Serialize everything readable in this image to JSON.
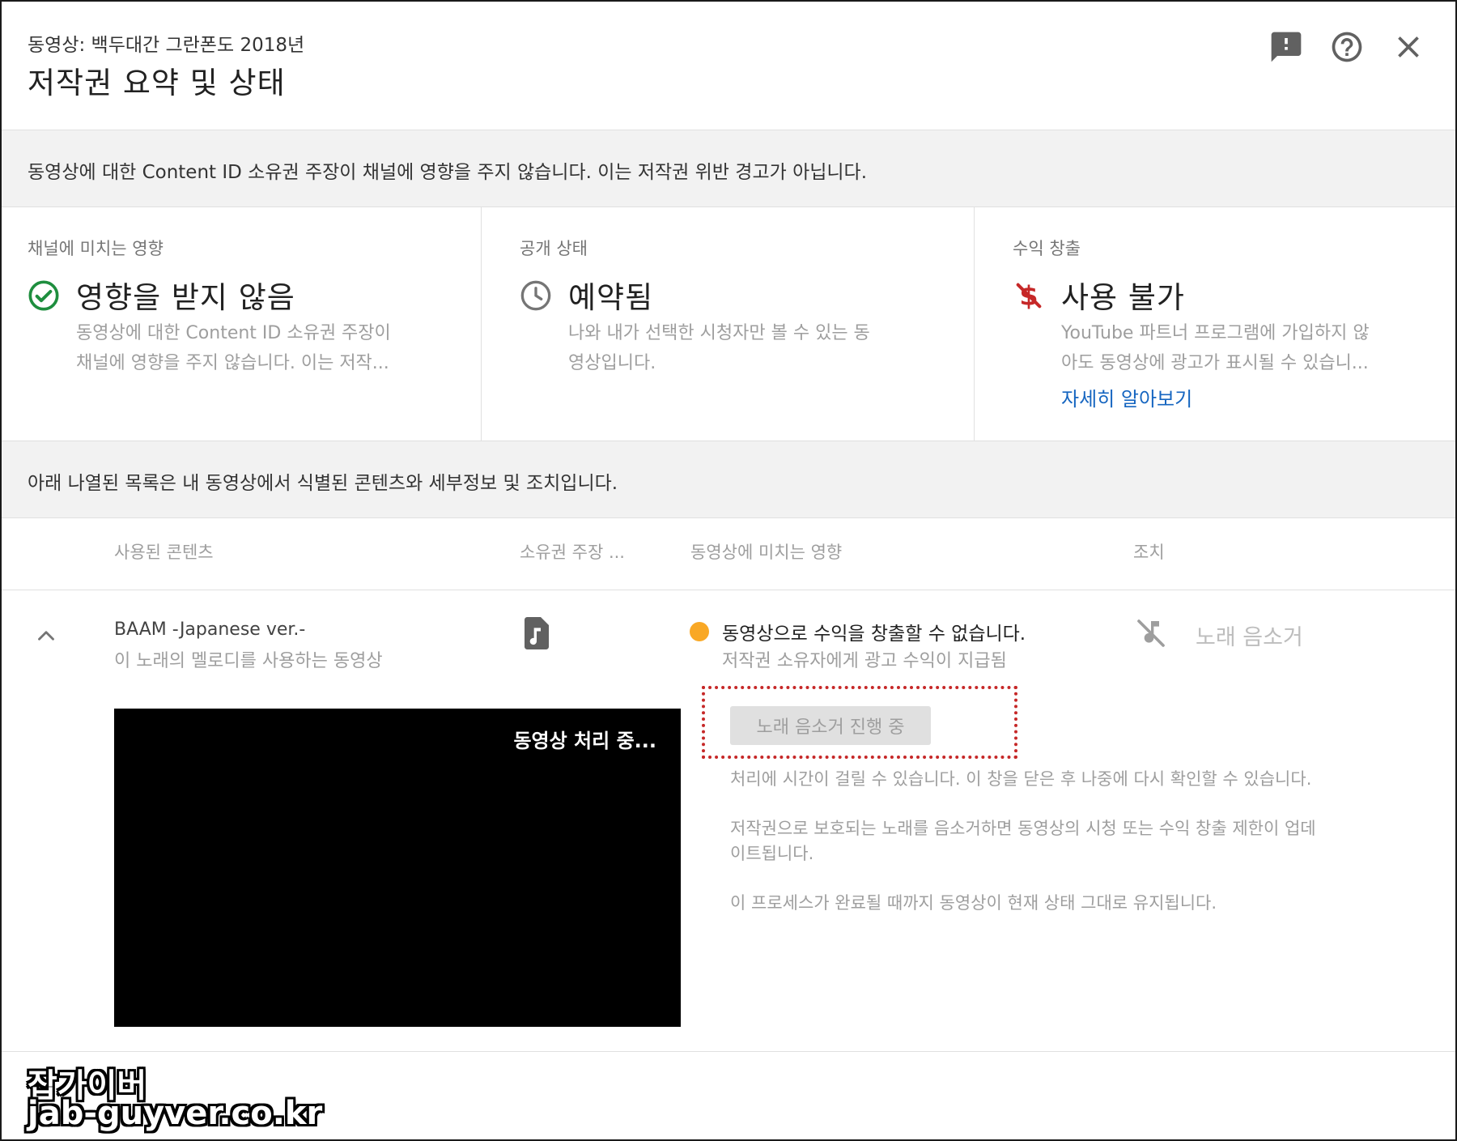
{
  "header": {
    "subtitle": "동영상: 백두대간 그란폰도 2018년",
    "title": "저작권 요약 및 상태",
    "icons": [
      "feedback-icon",
      "help-icon",
      "close-icon"
    ]
  },
  "banner_top": "동영상에 대한 Content ID 소유권 주장이 채널에 영향을 주지 않습니다. 이는 저작권 위반 경고가 아닙니다.",
  "cards": [
    {
      "label": "채널에 미치는 영향",
      "icon": "check-circle-icon",
      "title": "영향을 받지 않음",
      "desc_line1": "동영상에 대한 Content ID 소유권 주장이",
      "desc_line2": "채널에 영향을 주지 않습니다. 이는 저작..."
    },
    {
      "label": "공개 상태",
      "icon": "clock-icon",
      "title": "예약됨",
      "desc_line1": "나와 내가 선택한 시청자만 볼 수 있는 동",
      "desc_line2": "영상입니다."
    },
    {
      "label": "수익 창출",
      "icon": "no-money-icon",
      "title": "사용 불가",
      "desc_line1": "YouTube 파트너 프로그램에 가입하지 않",
      "desc_line2": "아도 동영상에 광고가 표시될 수 있습니...",
      "link": "자세히 알아보기"
    }
  ],
  "banner_list": "아래 나열된 목록은 내 동영상에서 식별된 콘텐츠와 세부정보 및 조치입니다.",
  "table": {
    "headers": [
      "사용된 콘텐츠",
      "소유권 주장 ...",
      "동영상에 미치는 영향",
      "조치"
    ]
  },
  "row": {
    "content_title": "BAAM -Japanese ver.-",
    "content_sub": "이 노래의 멜로디를 사용하는 동영상",
    "claim_icon": "music-note-icon",
    "impact_title": "동영상으로 수익을 창출할 수 없습니다.",
    "impact_sub": "저작권 소유자에게 광고 수익이 지급됨",
    "action_label": "노래 음소거",
    "video_overlay": "동영상 처리 중...",
    "status_pill": "노래 음소거 진행 중",
    "notes": [
      "처리에 시간이 걸릴 수 있습니다. 이 창을 닫은 후 나중에 다시 확인할 수 있습니다.",
      "저작권으로 보호되는 노래를 음소거하면 동영상의 시청 또는 수익 창출 제한이 업데",
      "이트됩니다.",
      "이 프로세스가 완료될 때까지 동영상이 현재 상태 그대로 유지됩니다."
    ]
  },
  "watermark": {
    "line1": "잡가이버",
    "line2": "jab-guyver.co.kr"
  },
  "colors": {
    "check": "#1e8e3e",
    "no_money": "#c62828",
    "link": "#1565c0",
    "status_dot": "#f9a825",
    "dotted_outline": "#c62828"
  }
}
